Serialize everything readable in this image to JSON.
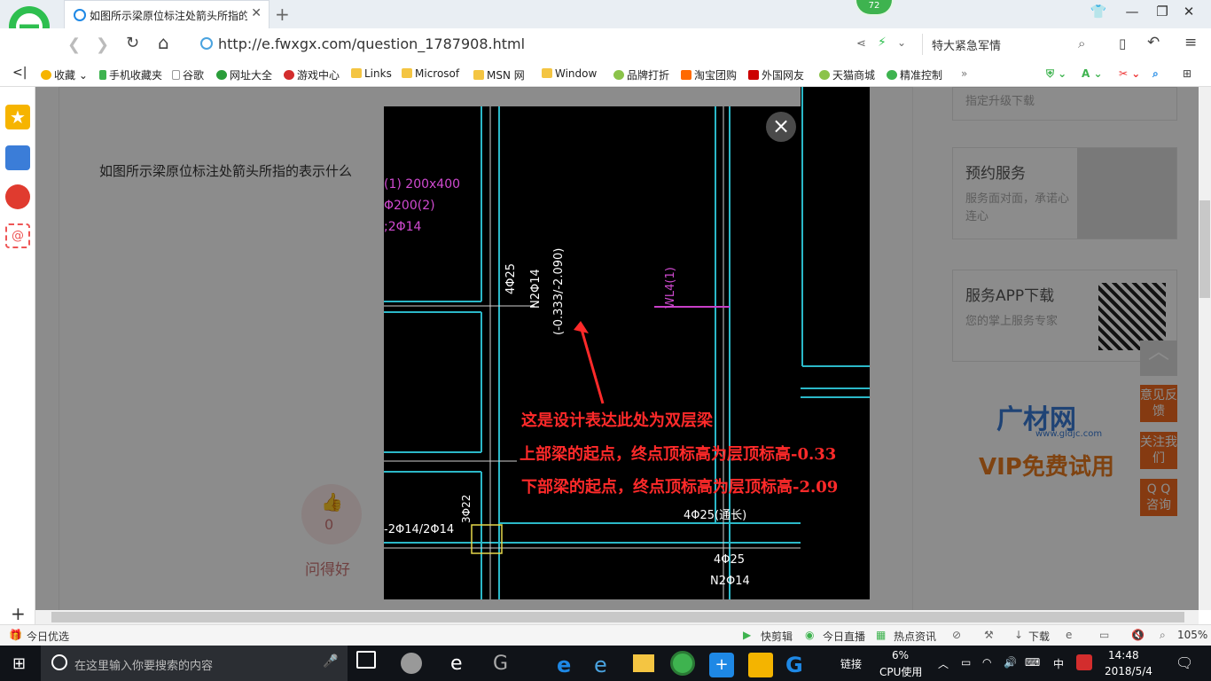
{
  "tab": {
    "title": "如图所示梁原位标注处箭头所指的表示什么",
    "badge": "72"
  },
  "address": {
    "url": "http://e.fwxgx.com/question_1787908.html",
    "search_text": "特大紧急军情"
  },
  "bookmarks": [
    "收藏",
    "手机收藏夹",
    "谷歌",
    "网址大全",
    "游戏中心",
    "Links",
    "Microsof",
    "MSN 网",
    "Window",
    "品牌打折",
    "淘宝团购",
    "外国网友",
    "天猫商城",
    "精准控制"
  ],
  "page": {
    "question": "如图所示梁原位标注处箭头所指的表示什么",
    "like_count": "0",
    "good_question": "问得好"
  },
  "sidebar_right": {
    "top_partial": "指定升级下载",
    "card1": {
      "title": "预约服务",
      "subtitle": "服务面对面，承诺心连心"
    },
    "card2": {
      "title": "服务APP下载",
      "subtitle": "您的掌上服务专家"
    },
    "ad_brand": "广材网",
    "ad_url": "www.gldjc.com",
    "ad_slogan": "VIP免费试用",
    "float_buttons": [
      "意见反馈",
      "关注我们",
      "Q Q 咨询"
    ]
  },
  "drawing": {
    "labels": {
      "l1": "(1) 200x400",
      "l2": "Φ200(2)",
      "l3": ";2Φ14",
      "v1": "4Φ25",
      "v2": "N2Φ14",
      "v3": "(-0.333/-2.090)",
      "wl": "WL4(1)",
      "b1": "-2Φ14/2Φ14",
      "b2": "3Φ22",
      "b3": "4Φ25(通长)",
      "b4": "4Φ25",
      "b5": "N2Φ14"
    },
    "annotation": [
      "这是设计表达此处为双层梁",
      "上部梁的起点，终点顶标高为层顶标高-0.33",
      "下部梁的起点，终点顶标高为层顶标高-2.09"
    ]
  },
  "statusbar": {
    "left": "今日优选",
    "items": [
      "快剪辑",
      "今日直播",
      "热点资讯"
    ],
    "download": "下载",
    "zoom": "105%"
  },
  "taskbar": {
    "search_placeholder": "在这里输入你要搜索的内容",
    "link": "链接",
    "cpu_pct": "6%",
    "cpu_label": "CPU使用",
    "ime": "中",
    "time": "14:48",
    "date": "2018/5/4"
  }
}
